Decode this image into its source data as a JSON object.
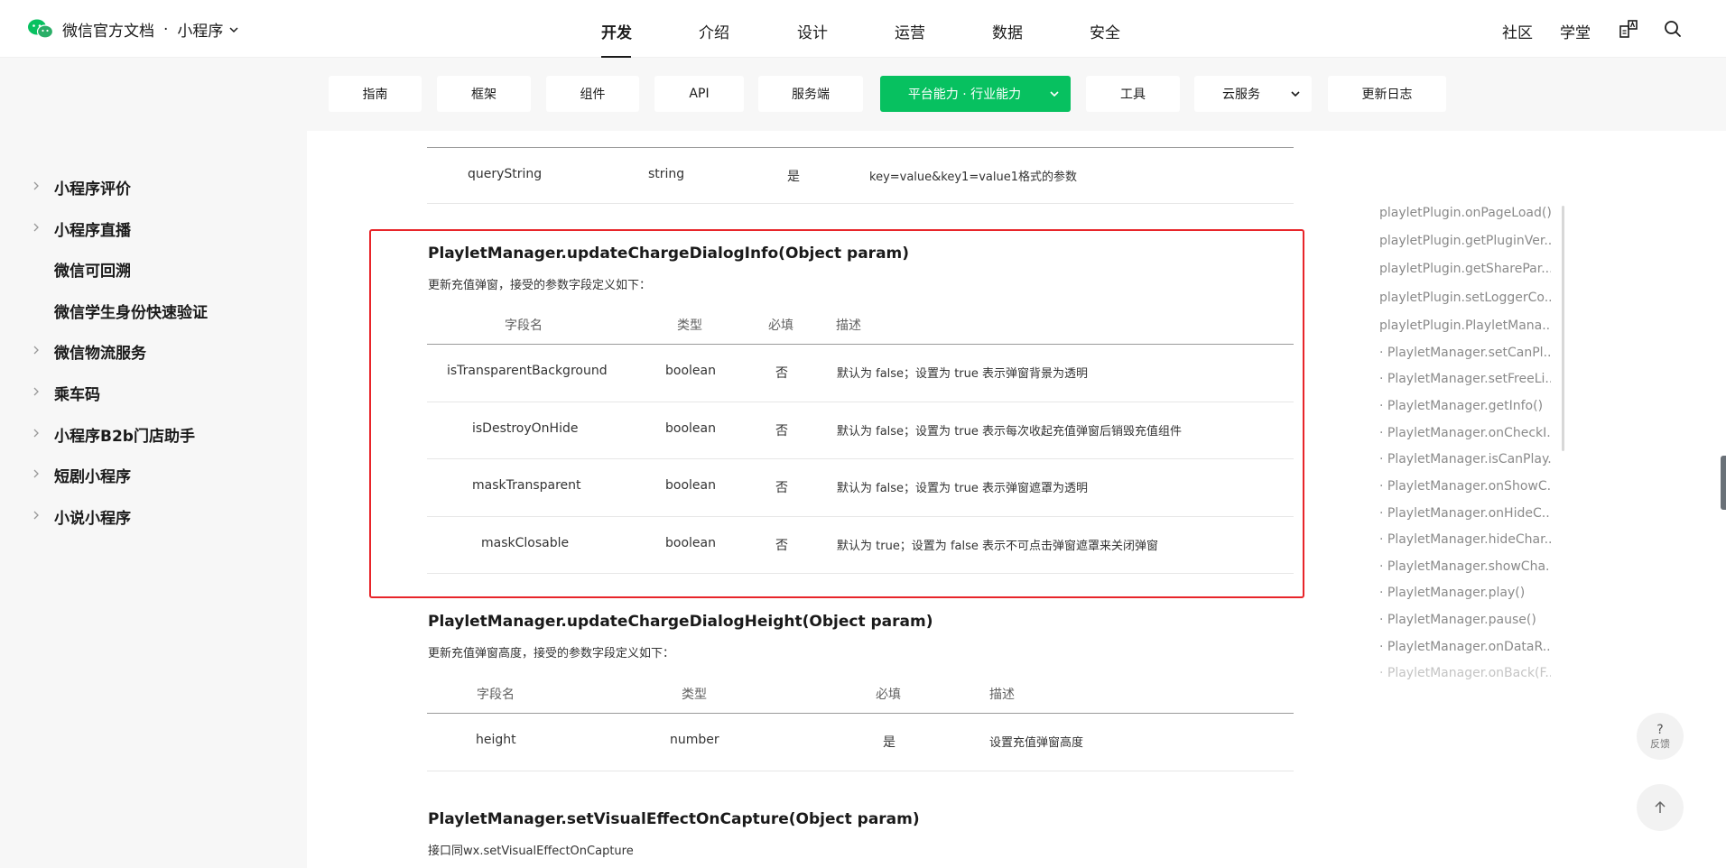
{
  "header": {
    "brand": "微信官方文档",
    "dot": "·",
    "product": "小程序",
    "nav": [
      {
        "label": "开发",
        "active": true
      },
      {
        "label": "介绍"
      },
      {
        "label": "设计"
      },
      {
        "label": "运营"
      },
      {
        "label": "数据"
      },
      {
        "label": "安全"
      }
    ],
    "right": {
      "community": "社区",
      "academy": "学堂"
    }
  },
  "subnav": {
    "tabs": [
      {
        "label": "指南"
      },
      {
        "label": "框架"
      },
      {
        "label": "组件"
      },
      {
        "label": "API"
      },
      {
        "label": "服务端"
      },
      {
        "label": "平台能力 · 行业能力",
        "active": true
      },
      {
        "label": "工具"
      },
      {
        "label": "云服务"
      },
      {
        "label": "更新日志"
      }
    ],
    "active_color": "#07c160"
  },
  "sidebar": {
    "items": [
      {
        "label": "小程序评价",
        "arrow": true
      },
      {
        "label": "小程序直播",
        "arrow": true
      },
      {
        "label": "微信可回溯",
        "arrow": false
      },
      {
        "label": "微信学生身份快速验证",
        "arrow": false
      },
      {
        "label": "微信物流服务",
        "arrow": true
      },
      {
        "label": "乘车码",
        "arrow": true
      },
      {
        "label": "小程序B2b门店助手",
        "arrow": true
      },
      {
        "label": "短剧小程序",
        "arrow": true
      },
      {
        "label": "小说小程序",
        "arrow": true
      }
    ]
  },
  "main": {
    "top_table": {
      "row": [
        "queryString",
        "string",
        "是",
        "key=value&key1=value1格式的参数"
      ]
    },
    "section1": {
      "title": "PlayletManager.updateChargeDialogInfo(Object param)",
      "desc": "更新充值弹窗，接受的参数字段定义如下：",
      "headers": [
        "字段名",
        "类型",
        "必填",
        "描述"
      ],
      "rows": [
        [
          "isTransparentBackground",
          "boolean",
          "否",
          "默认为 false；设置为 true 表示弹窗背景为透明"
        ],
        [
          "isDestroyOnHide",
          "boolean",
          "否",
          "默认为 false；设置为 true 表示每次收起充值弹窗后销毁充值组件"
        ],
        [
          "maskTransparent",
          "boolean",
          "否",
          "默认为 false；设置为 true 表示弹窗遮罩为透明"
        ],
        [
          "maskClosable",
          "boolean",
          "否",
          "默认为 true；设置为 false 表示不可点击弹窗遮罩来关闭弹窗"
        ]
      ],
      "highlight_color": "#e8252a"
    },
    "section2": {
      "title": "PlayletManager.updateChargeDialogHeight(Object param)",
      "desc": "更新充值弹窗高度，接受的参数字段定义如下：",
      "headers": [
        "字段名",
        "类型",
        "必填",
        "描述"
      ],
      "rows": [
        [
          "height",
          "number",
          "是",
          "设置充值弹窗高度"
        ]
      ]
    },
    "section3": {
      "title": "PlayletManager.setVisualEffectOnCapture(Object param)",
      "desc": "接口同wx.setVisualEffectOnCapture"
    }
  },
  "toc": {
    "items": [
      "playletPlugin.onPageLoad()",
      "playletPlugin.getPluginVer...",
      "playletPlugin.getSharePar...",
      "playletPlugin.setLoggerCo...",
      "playletPlugin.PlayletMana...",
      "· PlayletManager.setCanPl...",
      "· PlayletManager.setFreeLi...",
      "· PlayletManager.getInfo()",
      "· PlayletManager.onCheckI...",
      "· PlayletManager.isCanPlay...",
      "· PlayletManager.onShowC...",
      "· PlayletManager.onHideC...",
      "· PlayletManager.hideChar...",
      "· PlayletManager.showCha...",
      "· PlayletManager.play()",
      "· PlayletManager.pause()",
      "· PlayletManager.onDataR...",
      "· PlayletManager.onBack(F..."
    ]
  },
  "float": {
    "feedback_q": "?",
    "feedback_label": "反馈"
  }
}
